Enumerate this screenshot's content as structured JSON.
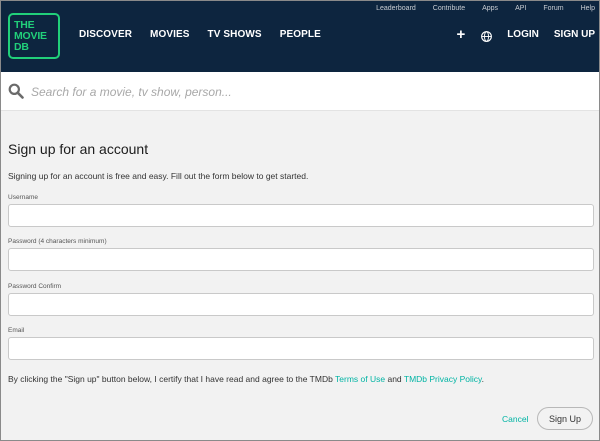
{
  "header": {
    "logo_lines": [
      "THE",
      "MOVIE",
      "DB"
    ],
    "main_nav": [
      "DISCOVER",
      "MOVIES",
      "TV SHOWS",
      "PEOPLE"
    ],
    "top_nav": [
      "Leaderboard",
      "Contribute",
      "Apps",
      "API",
      "Forum",
      "Help"
    ],
    "add_symbol": "+",
    "login_label": "LOGIN",
    "signup_label": "SIGN UP",
    "colors": {
      "background": "#0d253f",
      "accent": "#21d07a"
    }
  },
  "search": {
    "placeholder": "Search for a movie, tv show, person...",
    "value": ""
  },
  "form": {
    "title": "Sign up for an account",
    "intro": "Signing up for an account is free and easy. Fill out the form below to get started.",
    "fields": [
      {
        "label": "Username",
        "value": ""
      },
      {
        "label": "Password (4 characters minimum)",
        "value": ""
      },
      {
        "label": "Password Confirm",
        "value": ""
      },
      {
        "label": "Email",
        "value": ""
      }
    ],
    "terms_prefix": "By clicking the \"Sign up\" button below, I certify that I have read and agree to the TMDb ",
    "terms_link": "Terms of Use",
    "terms_and": " and ",
    "privacy_link": "TMDb Privacy Policy",
    "terms_suffix": ".",
    "cancel_label": "Cancel",
    "submit_label": "Sign Up",
    "link_color": "#01b4a4"
  }
}
